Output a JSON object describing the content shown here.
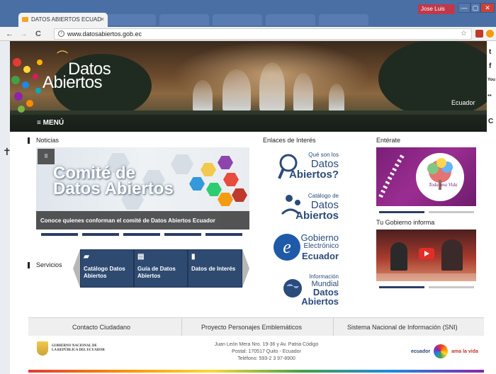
{
  "browser": {
    "tab_title": "DATOS ABIERTOS ECUAD",
    "tab_close": "×",
    "bg_tabs": [
      "",
      "",
      "",
      "",
      ""
    ],
    "user_label": "Jose Luis",
    "window_controls": [
      "—",
      "▢",
      "✕"
    ],
    "nav": {
      "back": "←",
      "forward": "→",
      "reload": "C"
    },
    "url": "www.datosabiertos.gob.ec",
    "star": "☆"
  },
  "header": {
    "logo_line1": "Datos",
    "logo_line2": "Abiertos",
    "country": "Ecuador",
    "menu_label": "≡ MENÚ"
  },
  "social": [
    "t",
    "f",
    "You",
    "▪▪",
    "C"
  ],
  "noticias": {
    "title": "Noticias",
    "pause_icon": "II",
    "headline_line1": "Comité de",
    "headline_line2": "Datos Abiertos",
    "caption": "Conoce quienes conforman el comité de Datos Abiertos Ecuador",
    "dots": 5
  },
  "servicios": {
    "title": "Servicios",
    "prev": "‹",
    "next": "›",
    "cards": [
      {
        "label": "Catálogo Datos Abiertos",
        "icon": "folder-icon",
        "glyph": "▰"
      },
      {
        "label": "Guía de Datos Abiertos",
        "icon": "document-icon",
        "glyph": "▤"
      },
      {
        "label": "Datos de Interés",
        "icon": "book-icon",
        "glyph": "▮"
      }
    ]
  },
  "enlaces": {
    "title": "Enlaces de Interés",
    "items": [
      {
        "line1": "Qué son los",
        "line2": "Datos",
        "line3": "Abiertos?"
      },
      {
        "line1": "Catálogo de",
        "line2": "Datos",
        "line3": "Abiertos"
      },
      {
        "line1": "Gobierno",
        "line2": "Electrónico",
        "line3": "Ecuador"
      },
      {
        "line1": "Información",
        "line2": "Mundial",
        "line3": "Datos Abiertos"
      }
    ]
  },
  "enterate": {
    "title": "Entérate",
    "image_text_line1": "Toda",
    "image_text_line2": "una",
    "image_text_line3": "Vida"
  },
  "gobierno": {
    "title": "Tu Gobierno informa"
  },
  "footer": {
    "links": [
      "Contacto Ciudadano",
      "Proyecto Personajes Emblemáticos",
      "Sistema Nacional de Información (SNI)"
    ],
    "gov_name_line1": "GOBIERNO NACIONAL DE",
    "gov_name_line2": "LA REPÚBLICA DEL ECUADOR",
    "address_line1": "Juan León Mera Nro. 19-36 y Av. Patria Código",
    "address_line2": "Postal: 170517 Quito - Ecuador",
    "address_line3": "Teléfono: 593-2 3 97-8900",
    "brand_left": "ecuador",
    "brand_right": "ama la vida"
  },
  "colors": {
    "nav_blue": "#2e4a70",
    "link_blue": "#2b4b7a",
    "enterate_purple": "#8e2a8a"
  }
}
